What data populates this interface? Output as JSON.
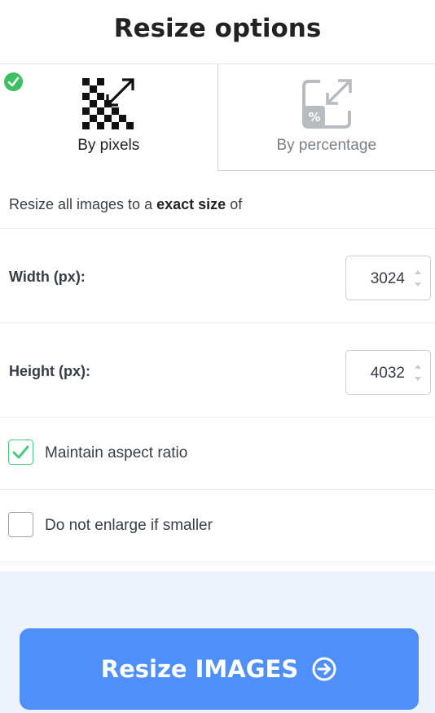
{
  "header": {
    "title": "Resize options"
  },
  "modes": [
    {
      "label": "By pixels",
      "icon": "pixels-resize-icon",
      "selected": true
    },
    {
      "label": "By percentage",
      "icon": "percentage-resize-icon",
      "selected": false
    }
  ],
  "description": {
    "prefix": "Resize all images to a",
    "emphasis": "exact size",
    "suffix": "of"
  },
  "width": {
    "label": "Width (px):",
    "value": "3024"
  },
  "height": {
    "label": "Height (px):",
    "value": "4032"
  },
  "options": {
    "maintain_aspect": {
      "label": "Maintain aspect ratio",
      "checked": true
    },
    "no_enlarge": {
      "label": "Do not enlarge if smaller",
      "checked": false
    }
  },
  "action": {
    "label": "Resize IMAGES",
    "icon": "arrow-right-circle-icon"
  },
  "colors": {
    "accent": "#4e8ffa",
    "success": "#3fbf63",
    "footer_bg": "#eef2fa"
  }
}
